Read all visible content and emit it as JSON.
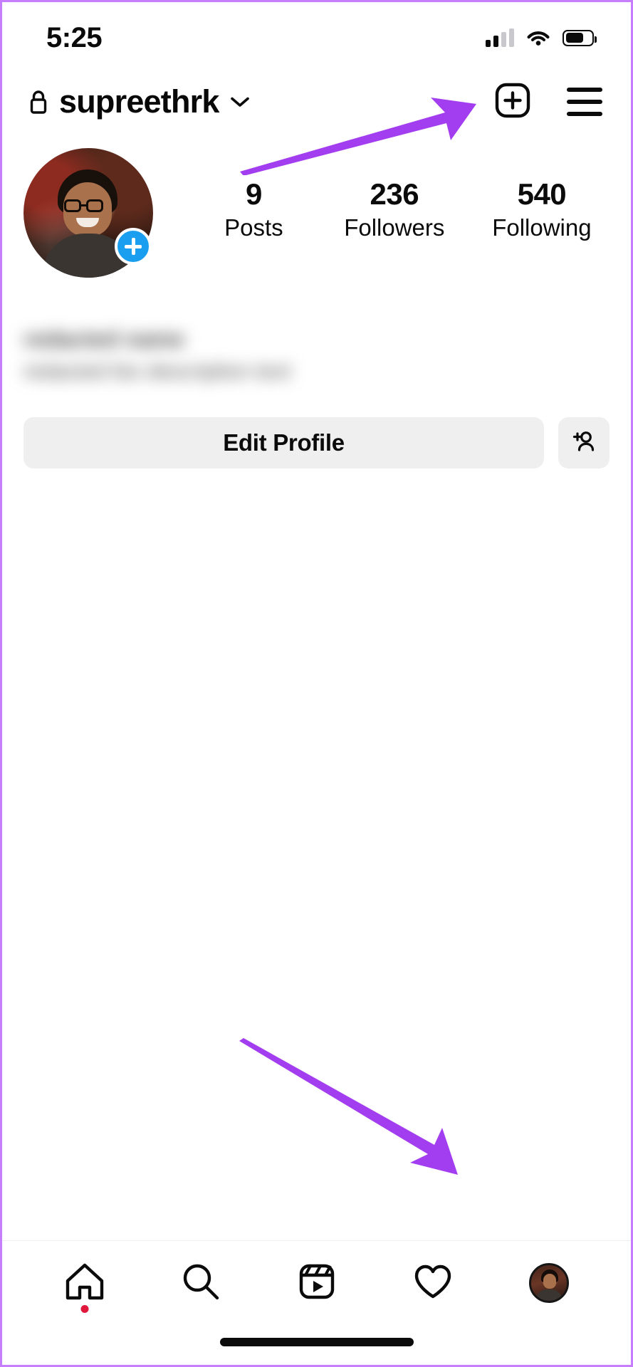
{
  "status_bar": {
    "time": "5:25",
    "signal_icon": "cellular-signal-icon",
    "signal_bars_filled": 2,
    "signal_bars_total": 4,
    "wifi_icon": "wifi-icon",
    "battery_icon": "battery-icon",
    "battery_level_percent": 60
  },
  "profile_header": {
    "lock_icon": "lock-icon",
    "username": "supreethrk",
    "chevron_icon": "chevron-down-icon",
    "new_post_icon": "new-post-plus-box-icon",
    "menu_icon": "hamburger-menu-icon"
  },
  "profile": {
    "avatar_name": "profile-avatar",
    "add_story_badge_icon": "plus-badge-icon",
    "stats": [
      {
        "value": "9",
        "label": "Posts"
      },
      {
        "value": "236",
        "label": "Followers"
      },
      {
        "value": "540",
        "label": "Following"
      }
    ],
    "bio_line_1": "redacted name",
    "bio_line_2": "redacted bio description text"
  },
  "actions": {
    "edit_profile_label": "Edit Profile",
    "add_person_icon": "add-person-icon"
  },
  "bottom_nav": {
    "items": [
      {
        "icon": "home-icon",
        "label": "Home",
        "badge": true
      },
      {
        "icon": "search-icon",
        "label": "Search",
        "badge": false
      },
      {
        "icon": "reels-icon",
        "label": "Reels",
        "badge": false
      },
      {
        "icon": "heart-icon",
        "label": "Activity",
        "badge": false
      },
      {
        "icon": "profile-avatar-icon",
        "label": "Profile",
        "badge": false
      }
    ],
    "home_indicator": "home-indicator"
  },
  "annotations": {
    "arrow_color": "#a33df0",
    "arrow_top_target": "hamburger-menu-icon",
    "arrow_bottom_target": "profile-tab-avatar"
  },
  "colors": {
    "accent_blue": "#1a9ff0",
    "button_bg": "#efefef",
    "badge_red": "#e0163a",
    "annotation_purple": "#a33df0",
    "device_border": "#c77dff"
  }
}
